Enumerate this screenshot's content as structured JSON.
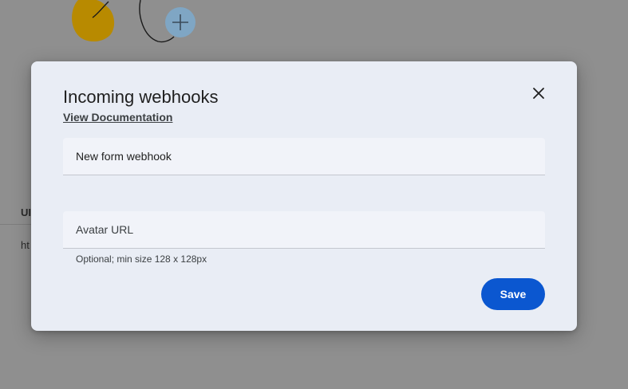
{
  "background": {
    "column_header": "UI",
    "cell_text": "ht"
  },
  "dialog": {
    "title": "Incoming webhooks",
    "documentation_link": "View Documentation",
    "name_field": {
      "value": "New form webhook"
    },
    "avatar_field": {
      "placeholder": "Avatar URL",
      "helper_text": "Optional; min size 128 x 128px"
    },
    "save_label": "Save"
  },
  "colors": {
    "accent": "#0b57d0",
    "dialog_bg": "#e9edf5",
    "scrim": "#8f8f8f",
    "illustration_yellow": "#b88a00",
    "illustration_blue": "#7fa6c4"
  },
  "icons": {
    "close": "close-icon",
    "add": "plus-icon"
  }
}
